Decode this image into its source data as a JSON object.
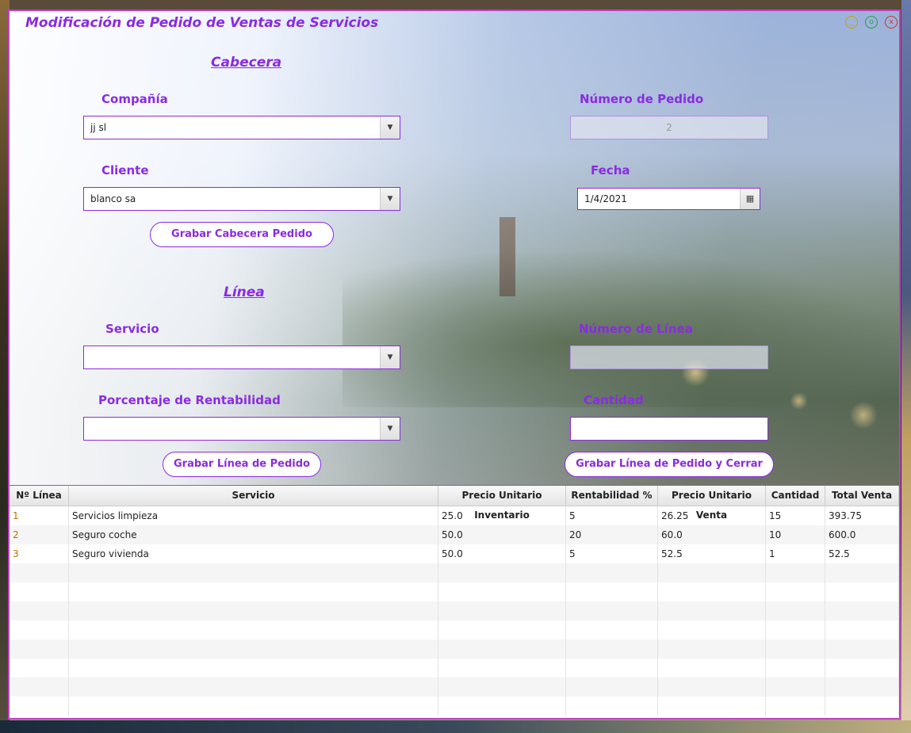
{
  "window": {
    "title": "Modificación de Pedido de Ventas de  Servicios",
    "minimize_icon": "_",
    "maximize_icon": "o",
    "close_icon": "x"
  },
  "header": {
    "section_title": "Cabecera",
    "company_label": "Compañía",
    "company_value": "jj sl",
    "order_number_label": "Número de Pedido",
    "order_number_value": "2",
    "client_label": "Cliente",
    "client_value": "blanco sa",
    "date_label": "Fecha",
    "date_value": "1/4/2021",
    "save_header_button": "Grabar Cabecera Pedido"
  },
  "line": {
    "section_title": "Línea",
    "service_label": "Servicio",
    "service_value": "",
    "line_number_label": "Número de Línea",
    "line_number_value": "",
    "profit_label": "Porcentaje de Rentabilidad",
    "profit_value": "",
    "quantity_label": "Cantidad",
    "quantity_value": "",
    "save_line_button": "Grabar Línea de Pedido",
    "save_line_close_button": "Grabar Línea de Pedido y Cerrar"
  },
  "table": {
    "columns": [
      "Nº Línea",
      "Servicio",
      "Precio Unitario Inventario",
      "Rentabilidad %",
      "Precio Unitario Venta",
      "Cantidad",
      "Total Venta"
    ],
    "rows": [
      [
        "1",
        "Servicios limpieza",
        "25.0",
        "5",
        "26.25",
        "15",
        "393.75"
      ],
      [
        "2",
        "Seguro coche",
        "50.0",
        "20",
        "60.0",
        "10",
        "600.0"
      ],
      [
        "3",
        "Seguro vivienda",
        "50.0",
        "5",
        "52.5",
        "1",
        "52.5"
      ]
    ]
  },
  "icons": {
    "combo_arrow": "chevron-down-icon",
    "calendar": "calendar-icon"
  },
  "colors": {
    "accent": "#8a2be2",
    "border": "#c040c0"
  }
}
